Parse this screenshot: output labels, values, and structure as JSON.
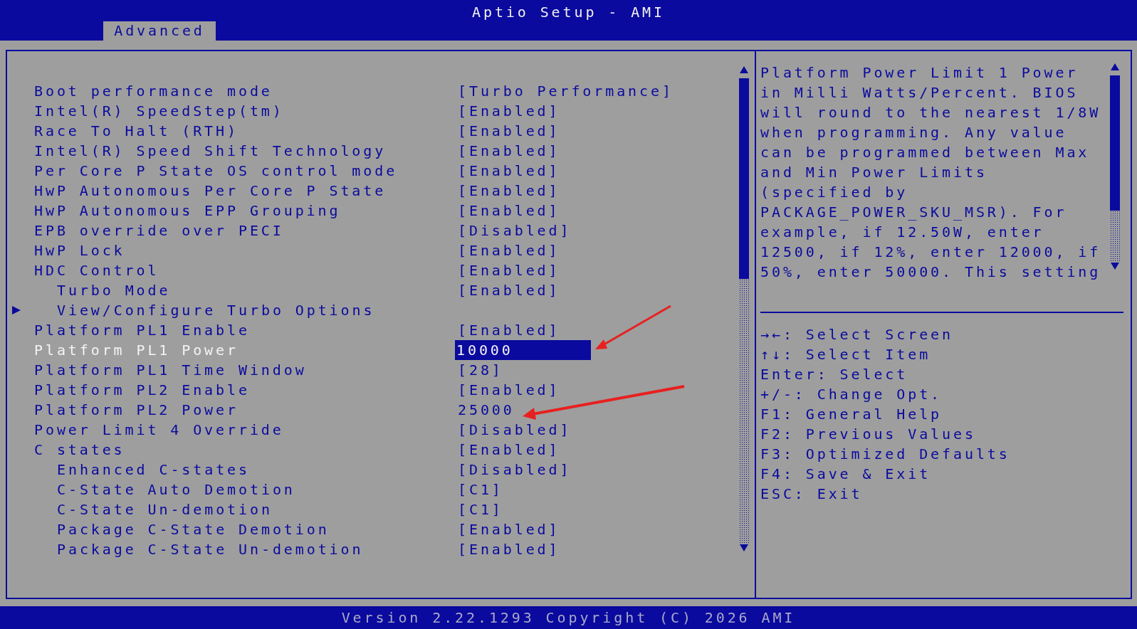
{
  "window": {
    "title": "Aptio Setup - AMI"
  },
  "tabs": [
    {
      "label": "Advanced",
      "selected": true
    }
  ],
  "settings": [
    {
      "kind": "setting",
      "label": "Boot performance mode",
      "value": "[Turbo Performance]",
      "indent": false,
      "selected": false
    },
    {
      "kind": "setting",
      "label": "Intel(R) SpeedStep(tm)",
      "value": "[Enabled]",
      "indent": false,
      "selected": false
    },
    {
      "kind": "setting",
      "label": "Race To Halt (RTH)",
      "value": "[Enabled]",
      "indent": false,
      "selected": false
    },
    {
      "kind": "setting",
      "label": "Intel(R) Speed Shift Technology",
      "value": "[Enabled]",
      "indent": false,
      "selected": false
    },
    {
      "kind": "setting",
      "label": "Per Core P State OS control mode",
      "value": "[Enabled]",
      "indent": false,
      "selected": false
    },
    {
      "kind": "setting",
      "label": "HwP Autonomous Per Core P State",
      "value": "[Enabled]",
      "indent": false,
      "selected": false
    },
    {
      "kind": "setting",
      "label": "HwP Autonomous EPP Grouping",
      "value": "[Enabled]",
      "indent": false,
      "selected": false
    },
    {
      "kind": "setting",
      "label": "EPB override over PECI",
      "value": "[Disabled]",
      "indent": false,
      "selected": false
    },
    {
      "kind": "setting",
      "label": "HwP Lock",
      "value": "[Enabled]",
      "indent": false,
      "selected": false
    },
    {
      "kind": "setting",
      "label": "HDC Control",
      "value": "[Enabled]",
      "indent": false,
      "selected": false
    },
    {
      "kind": "setting",
      "label": "Turbo Mode",
      "value": "[Enabled]",
      "indent": true,
      "selected": false
    },
    {
      "kind": "submenu",
      "label": "View/Configure Turbo Options",
      "indent": true,
      "selected": false
    },
    {
      "kind": "setting",
      "label": "Platform PL1 Enable",
      "value": "[Enabled]",
      "indent": false,
      "selected": false
    },
    {
      "kind": "setting",
      "label": "Platform PL1 Power",
      "value": "10000",
      "indent": false,
      "selected": true
    },
    {
      "kind": "setting",
      "label": "Platform PL1 Time Window",
      "value": "[28]",
      "indent": false,
      "selected": false
    },
    {
      "kind": "setting",
      "label": "Platform PL2 Enable",
      "value": "[Enabled]",
      "indent": false,
      "selected": false
    },
    {
      "kind": "setting",
      "label": "Platform PL2 Power",
      "value": "25000",
      "indent": false,
      "selected": false
    },
    {
      "kind": "setting",
      "label": "Power Limit 4 Override",
      "value": "[Disabled]",
      "indent": false,
      "selected": false
    },
    {
      "kind": "setting",
      "label": "C states",
      "value": "[Enabled]",
      "indent": false,
      "selected": false
    },
    {
      "kind": "setting",
      "label": "Enhanced C-states",
      "value": "[Disabled]",
      "indent": true,
      "selected": false
    },
    {
      "kind": "setting",
      "label": "C-State Auto Demotion",
      "value": "[C1]",
      "indent": true,
      "selected": false
    },
    {
      "kind": "setting",
      "label": "C-State Un-demotion",
      "value": "[C1]",
      "indent": true,
      "selected": false
    },
    {
      "kind": "setting",
      "label": "Package C-State Demotion",
      "value": "[Enabled]",
      "indent": true,
      "selected": false
    },
    {
      "kind": "setting",
      "label": "Package C-State Un-demotion",
      "value": "[Enabled]",
      "indent": true,
      "selected": false
    }
  ],
  "help_text": [
    "Platform Power Limit 1 Power",
    "in Milli Watts/Percent. BIOS",
    "will round to the nearest 1/8W",
    "when programming. Any value",
    "can be programmed between Max",
    "and Min Power Limits",
    "(specified by",
    "PACKAGE_POWER_SKU_MSR). For",
    "example, if 12.50W, enter",
    "12500, if 12%, enter 12000, if",
    "50%, enter 50000. This setting"
  ],
  "key_hints": [
    "→←: Select Screen",
    "↑↓: Select Item",
    "Enter: Select",
    "+/-: Change Opt.",
    "F1: General Help",
    "F2: Previous Values",
    "F3: Optimized Defaults",
    "F4: Save & Exit",
    "ESC: Exit"
  ],
  "status_bar": "Version 2.22.1293 Copyright (C) 2026 AMI"
}
